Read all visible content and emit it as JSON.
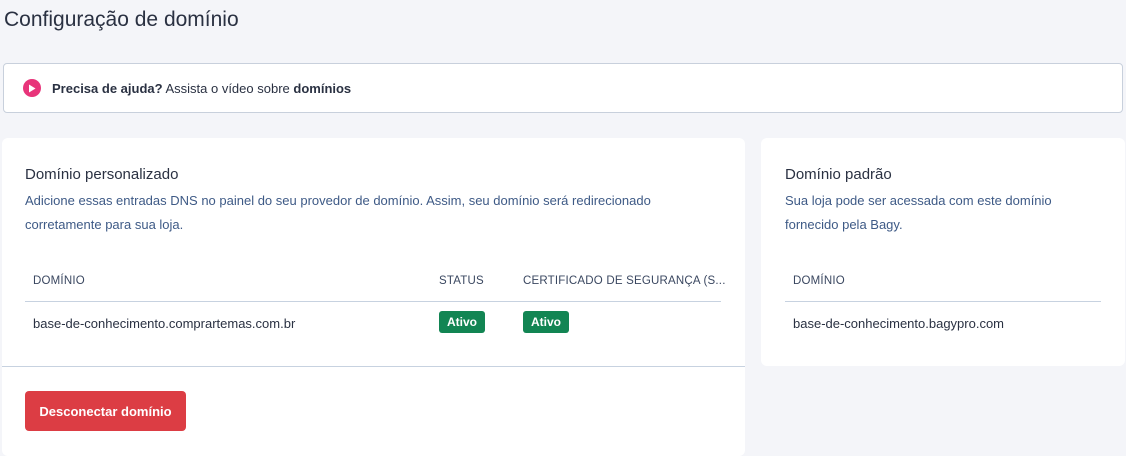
{
  "page_title": "Configuração de domínio",
  "help_banner": {
    "bold_prefix": "Precisa de ajuda?",
    "text": "Assista o vídeo sobre",
    "bold_link": "domínios",
    "icon": "play-icon"
  },
  "custom_domain": {
    "title": "Domínio personalizado",
    "description": "Adicione essas entradas DNS no painel do seu provedor de domínio. Assim, seu domínio será redirecionado corretamente para sua loja.",
    "columns": [
      "DOMÍNIO",
      "STATUS",
      "CERTIFICADO DE SEGURANÇA (S..."
    ],
    "row": {
      "domain": "base-de-conhecimento.comprartemas.com.br",
      "status": "Ativo",
      "certificate": "Ativo"
    },
    "disconnect_label": "Desconectar domínio"
  },
  "default_domain": {
    "title": "Domínio padrão",
    "description": "Sua loja pode ser acessada com este domínio fornecido pela Bagy.",
    "column": "DOMÍNIO",
    "domain": "base-de-conhecimento.bagypro.com"
  },
  "colors": {
    "accent_pink": "#e8347a",
    "success_green": "#128553",
    "danger_red": "#dc3d44",
    "link_blue": "#3e5a86"
  }
}
